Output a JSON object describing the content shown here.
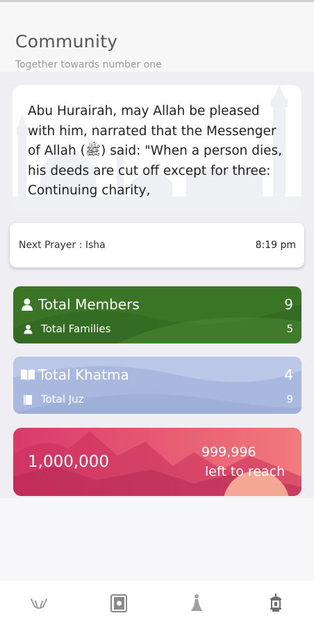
{
  "header": {
    "title": "Community",
    "subtitle": "Together towards number one"
  },
  "hadith": {
    "text": "Abu Hurairah, may Allah be pleased with him, narrated that the Messenger of Allah (ﷺ) said: \"When a person dies, his deeds are cut off except for three: Continuing charity,"
  },
  "prayer": {
    "label": "Next Prayer : Isha",
    "time": "8:19 pm"
  },
  "members": {
    "label": "Total Members",
    "value": "9",
    "sub_label": "Total Families",
    "sub_value": "5",
    "color": "#3a7526"
  },
  "khatma": {
    "label": "Total Khatma",
    "value": "4",
    "sub_label": "Total Juz",
    "sub_value": "9",
    "color": "#a9b8de"
  },
  "goal": {
    "total": "1,000,000",
    "remaining": "999,996",
    "remaining_label": "left to reach",
    "color": "#e8527a"
  },
  "nav": {
    "items": [
      {
        "icon": "praying-hands-icon"
      },
      {
        "icon": "quran-book-icon"
      },
      {
        "icon": "person-praying-icon"
      },
      {
        "icon": "lantern-icon"
      }
    ]
  }
}
